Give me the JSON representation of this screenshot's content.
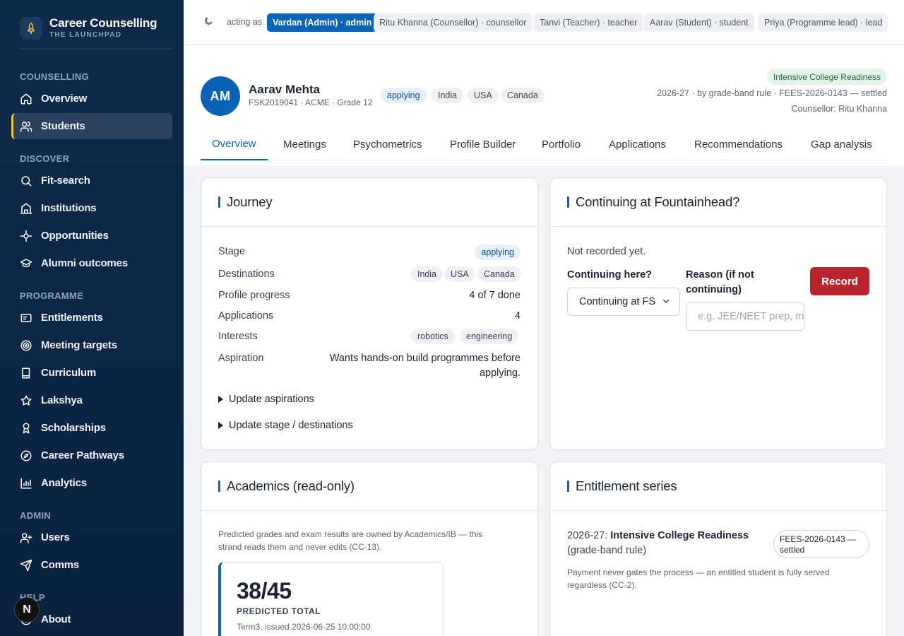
{
  "brand": {
    "title": "Career Counselling",
    "subtitle": "THE LAUNCHPAD"
  },
  "sidebar": {
    "sections": [
      {
        "label": "COUNSELLING"
      },
      {
        "label": "DISCOVER"
      },
      {
        "label": "PROGRAMME"
      },
      {
        "label": "ADMIN"
      },
      {
        "label": "HELP"
      }
    ],
    "items": [
      {
        "label": "Overview",
        "icon": "home-icon"
      },
      {
        "label": "Students",
        "icon": "users-icon",
        "active": true
      },
      {
        "label": "Fit-search",
        "icon": "search-icon"
      },
      {
        "label": "Institutions",
        "icon": "institution-icon"
      },
      {
        "label": "Opportunities",
        "icon": "sparkle-icon"
      },
      {
        "label": "Alumni outcomes",
        "icon": "graduation-cap-icon"
      },
      {
        "label": "Entitlements",
        "icon": "id-card-icon"
      },
      {
        "label": "Meeting targets",
        "icon": "target-icon"
      },
      {
        "label": "Curriculum",
        "icon": "book-icon"
      },
      {
        "label": "Lakshya",
        "icon": "star-icon"
      },
      {
        "label": "Scholarships",
        "icon": "award-icon"
      },
      {
        "label": "Career Pathways",
        "icon": "compass-icon"
      },
      {
        "label": "Analytics",
        "icon": "bar-chart-icon"
      },
      {
        "label": "Users",
        "icon": "user-plus-icon"
      },
      {
        "label": "Comms",
        "icon": "send-icon"
      },
      {
        "label": "About",
        "icon": "info-icon"
      }
    ]
  },
  "next_badge": "N",
  "topbar": {
    "acting_label": "acting as",
    "roles": [
      {
        "label": "Vardan (Admin) · admin",
        "active": true
      },
      {
        "label": "Ritu Khanna (Counsellor) · counsellor"
      },
      {
        "label": "Tanvi (Teacher) · teacher"
      },
      {
        "label": "Aarav (Student) · student"
      },
      {
        "label": "Priya (Programme lead) · lead"
      }
    ]
  },
  "student": {
    "initials": "AM",
    "name": "Aarav Mehta",
    "meta": "FSK2019041 · ACME · Grade 12",
    "stage": "applying",
    "destinations": [
      "India",
      "USA",
      "Canada"
    ],
    "programme": "Intensive College Readiness",
    "fees_line": "2026-27 · by grade-band rule · FEES-2026-0143 — settled",
    "counsellor_line": "Counsellor: Ritu Khanna"
  },
  "tabs": [
    "Overview",
    "Meetings",
    "Psychometrics",
    "Profile Builder",
    "Portfolio",
    "Applications",
    "Recommendations",
    "Gap analysis"
  ],
  "journey": {
    "title": "Journey",
    "stage_label": "Stage",
    "stage_value": "applying",
    "destinations_label": "Destinations",
    "destinations": [
      "India",
      "USA",
      "Canada"
    ],
    "progress_label": "Profile progress",
    "progress_value": "4 of 7 done",
    "applications_label": "Applications",
    "applications_value": "4",
    "interests_label": "Interests",
    "interests": [
      "robotics",
      "engineering"
    ],
    "aspiration_label": "Aspiration",
    "aspiration_line1": "Wants hands-on build programmes before",
    "aspiration_line2": "applying.",
    "update_aspirations": "Update aspirations",
    "update_stage": "Update stage / destinations"
  },
  "continuing": {
    "title": "Continuing at Fountainhead?",
    "status": "Not recorded yet.",
    "q_label": "Continuing here?",
    "select_value": "Continuing at FS",
    "reason_label_1": "Reason (if not",
    "reason_label_2": "continuing)",
    "reason_placeholder": "e.g. JEE/NEET prep, moving abroad",
    "record_button": "Record"
  },
  "academics": {
    "title": "Academics (read-only)",
    "note_line1": "Predicted grades and exam results are owned by Academics/IB — this",
    "note_line2": "strand reads them and never edits (CC-13).",
    "grade_value": "38/45",
    "grade_label": "PREDICTED TOTAL",
    "grade_issued": "Term3, issued 2026-06-25 10:00:00"
  },
  "entitlement": {
    "title": "Entitlement series",
    "year_prefix": "2026-27: ",
    "programme": "Intensive College Readiness",
    "rule": "(grade-band rule)",
    "badge_line1": "FEES-2026-0143 —",
    "badge_line2": "settled",
    "note_line1": "Payment never gates the process — an entitled student is fully served",
    "note_line2": "regardless (CC-2)."
  }
}
